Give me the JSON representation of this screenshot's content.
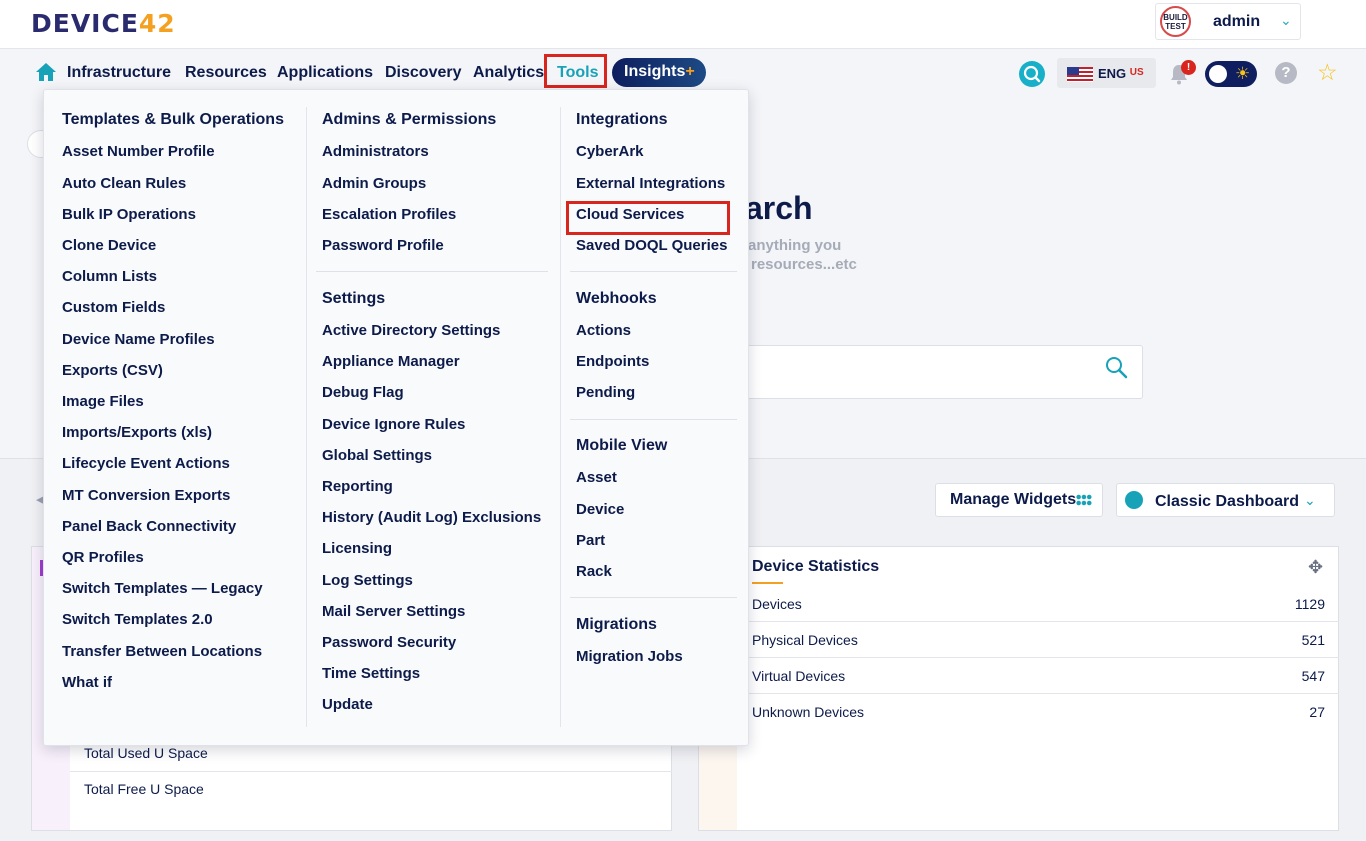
{
  "header": {
    "logo_main": "DEVICE",
    "logo_num": "42",
    "build_badge_line1": "BUILD",
    "build_badge_line2": "TEST",
    "user": "admin"
  },
  "nav": {
    "items": [
      "Infrastructure",
      "Resources",
      "Applications",
      "Discovery",
      "Analytics"
    ],
    "active": "Tools",
    "insights": "Insights",
    "insights_plus": "+",
    "lang": "ENG",
    "lang_region": "US",
    "notification_badge": "!"
  },
  "tools_menu": {
    "col1": {
      "heading": "Templates & Bulk Operations",
      "links": [
        "Asset Number Profile",
        "Auto Clean Rules",
        "Bulk IP Operations",
        "Clone Device",
        "Column Lists",
        "Custom Fields",
        "Device Name Profiles",
        "Exports (CSV)",
        "Image Files",
        "Imports/Exports (xls)",
        "Lifecycle Event Actions",
        "MT Conversion Exports",
        "Panel Back Connectivity",
        "QR Profiles",
        "Switch Templates — Legacy",
        "Switch Templates 2.0",
        "Transfer Between Locations",
        "What if"
      ]
    },
    "col2_admins": {
      "heading": "Admins & Permissions",
      "links": [
        "Administrators",
        "Admin Groups",
        "Escalation Profiles",
        "Password Profile"
      ]
    },
    "col2_settings": {
      "heading": "Settings",
      "links": [
        "Active Directory Settings",
        "Appliance Manager",
        "Debug Flag",
        "Device Ignore Rules",
        "Global Settings",
        "Reporting",
        "History (Audit Log) Exclusions",
        "Licensing",
        "Log Settings",
        "Mail Server Settings",
        "Password Security",
        "Time Settings",
        "Update"
      ]
    },
    "col3_integrations": {
      "heading": "Integrations",
      "links": [
        "CyberArk",
        "External Integrations",
        "Cloud Services",
        "Saved DOQL Queries"
      ]
    },
    "col3_webhooks": {
      "heading": "Webhooks",
      "links": [
        "Actions",
        "Endpoints",
        "Pending"
      ]
    },
    "col3_mobile": {
      "heading": "Mobile View",
      "links": [
        "Asset",
        "Device",
        "Part",
        "Rack"
      ]
    },
    "col3_migrations": {
      "heading": "Migrations",
      "links": [
        "Migration Jobs"
      ]
    }
  },
  "background": {
    "search_title": "arch",
    "search_sub1": "anything you",
    "search_sub2": "resources...etc",
    "manage_widgets": "Manage Widgets",
    "dashboard_select": "Classic Dashboard",
    "left_rows": [
      "Total Used U Space",
      "Total Free U Space"
    ],
    "device_stats": {
      "title": "Device Statistics",
      "rows": [
        {
          "label": "Devices",
          "value": "1129"
        },
        {
          "label": "Physical Devices",
          "value": "521"
        },
        {
          "label": "Virtual Devices",
          "value": "547"
        },
        {
          "label": "Unknown Devices",
          "value": "27"
        }
      ]
    }
  },
  "colors": {
    "navy": "#0d1b4a",
    "teal": "#17a2b8",
    "highlight_red": "#d8261e",
    "orange": "#f4a021"
  }
}
